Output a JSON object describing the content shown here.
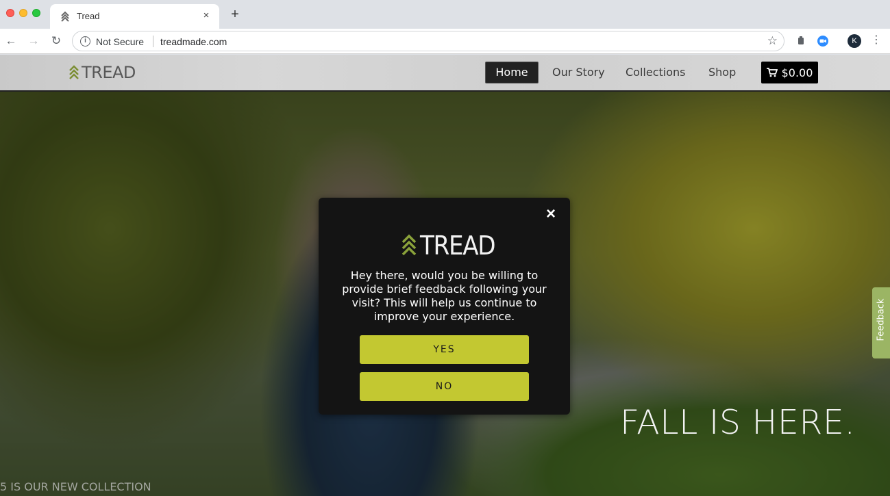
{
  "browser": {
    "tab_title": "Tread",
    "tab_close": "×",
    "new_tab": "+",
    "back": "←",
    "forward": "→",
    "reload": "↻",
    "security_label": "Not Secure",
    "url": "treadmade.com",
    "profile_initial": "K",
    "menu": "⋮",
    "star": "☆"
  },
  "site": {
    "logo_text": "TREAD",
    "nav": {
      "home": "Home",
      "story": "Our Story",
      "collections": "Collections",
      "shop": "Shop"
    },
    "cart_total": "$0.00",
    "accent_color": "#c3c831"
  },
  "hero": {
    "heading": "FALL IS HERE.",
    "subtext": "5 IS OUR NEW COLLECTION"
  },
  "feedback_tab": "Feedback",
  "modal": {
    "logo_text": "TREAD",
    "message": "Hey there, would you be willing to provide brief feedback following your visit? This will help us continue to improve your experience.",
    "yes_label": "YES",
    "no_label": "NO",
    "close": "×"
  }
}
